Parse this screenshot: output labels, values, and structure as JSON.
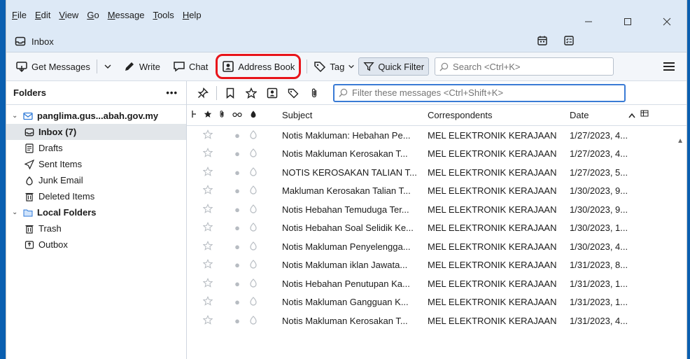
{
  "menu": {
    "items": [
      {
        "accel": "F",
        "rest": "ile"
      },
      {
        "accel": "E",
        "rest": "dit"
      },
      {
        "accel": "V",
        "rest": "iew"
      },
      {
        "accel": "G",
        "rest": "o"
      },
      {
        "accel": "M",
        "rest": "essage"
      },
      {
        "accel": "T",
        "rest": "ools"
      },
      {
        "accel": "H",
        "rest": "elp"
      }
    ]
  },
  "tab": {
    "title": "Inbox"
  },
  "toolbar": {
    "get_messages": "Get Messages",
    "write": "Write",
    "chat": "Chat",
    "address_book": "Address Book",
    "tag": "Tag",
    "quick_filter": "Quick Filter",
    "search_placeholder": "Search <Ctrl+K>"
  },
  "folders": {
    "header": "Folders",
    "account": "panglima.gus...abah.gov.my",
    "items": [
      {
        "label": "Inbox (7)",
        "icon": "inbox-icon"
      },
      {
        "label": "Drafts",
        "icon": "drafts-icon"
      },
      {
        "label": "Sent Items",
        "icon": "sent-icon"
      },
      {
        "label": "Junk Email",
        "icon": "junk-icon"
      },
      {
        "label": "Deleted Items",
        "icon": "trash-icon"
      }
    ],
    "local": "Local Folders",
    "local_items": [
      {
        "label": "Trash",
        "icon": "trash-icon"
      },
      {
        "label": "Outbox",
        "icon": "outbox-icon"
      }
    ]
  },
  "filter": {
    "placeholder": "Filter these messages <Ctrl+Shift+K>"
  },
  "columns": {
    "subject": "Subject",
    "correspondents": "Correspondents",
    "date": "Date"
  },
  "messages": [
    {
      "subject": "Notis Makluman: Hebahan Pe...",
      "from": "MEL ELEKTRONIK KERAJAAN",
      "date": "1/27/2023, 4..."
    },
    {
      "subject": "Notis Makluman Kerosakan T...",
      "from": "MEL ELEKTRONIK KERAJAAN",
      "date": "1/27/2023, 4..."
    },
    {
      "subject": "NOTIS KEROSAKAN TALIAN T...",
      "from": "MEL ELEKTRONIK KERAJAAN",
      "date": "1/27/2023, 5..."
    },
    {
      "subject": "Makluman Kerosakan Talian T...",
      "from": "MEL ELEKTRONIK KERAJAAN",
      "date": "1/30/2023, 9..."
    },
    {
      "subject": "Notis Hebahan Temuduga Ter...",
      "from": "MEL ELEKTRONIK KERAJAAN",
      "date": "1/30/2023, 9..."
    },
    {
      "subject": "Notis Hebahan Soal Selidik Ke...",
      "from": "MEL ELEKTRONIK KERAJAAN",
      "date": "1/30/2023, 1..."
    },
    {
      "subject": "Notis Makluman Penyelengga...",
      "from": "MEL ELEKTRONIK KERAJAAN",
      "date": "1/30/2023, 4..."
    },
    {
      "subject": "Notis Makluman iklan Jawata...",
      "from": "MEL ELEKTRONIK KERAJAAN",
      "date": "1/31/2023, 8..."
    },
    {
      "subject": "Notis Hebahan Penutupan Ka...",
      "from": "MEL ELEKTRONIK KERAJAAN",
      "date": "1/31/2023, 1..."
    },
    {
      "subject": "Notis Makluman Gangguan K...",
      "from": "MEL ELEKTRONIK KERAJAAN",
      "date": "1/31/2023, 1..."
    },
    {
      "subject": "Notis Makluman Kerosakan T...",
      "from": "MEL ELEKTRONIK KERAJAAN",
      "date": "1/31/2023, 4..."
    }
  ],
  "colors": {
    "accent": "#3a7bd5",
    "highlight_ring": "#e8141a",
    "desktop": "#0a5fb0"
  }
}
